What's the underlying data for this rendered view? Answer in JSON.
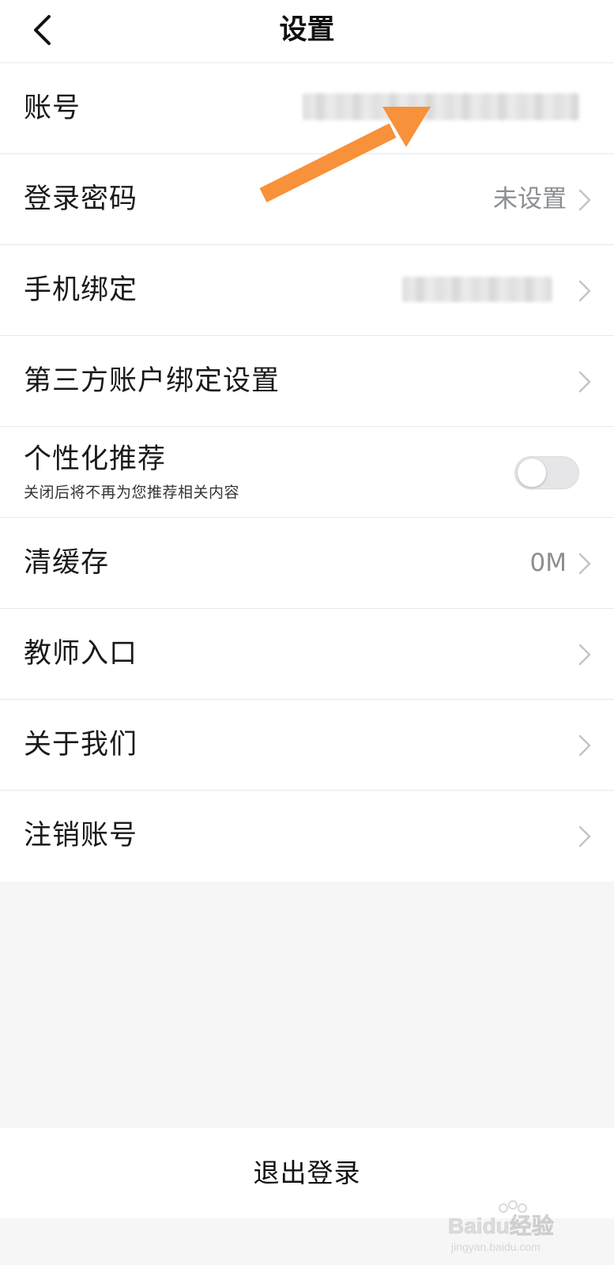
{
  "header": {
    "title": "设置",
    "back_icon": "chevron-left-icon"
  },
  "settings": {
    "account": {
      "label": "账号",
      "value_blurred": true
    },
    "login_password": {
      "label": "登录密码",
      "value": "未设置"
    },
    "phone_binding": {
      "label": "手机绑定",
      "value_blurred": true
    },
    "third_party": {
      "label": "第三方账户绑定设置"
    },
    "personalized": {
      "label": "个性化推荐",
      "subtitle": "关闭后将不再为您推荐相关内容",
      "enabled": false
    },
    "clear_cache": {
      "label": "清缓存",
      "value": "0M"
    },
    "teacher_entry": {
      "label": "教师入口"
    },
    "about_us": {
      "label": "关于我们"
    },
    "delete_account": {
      "label": "注销账号"
    }
  },
  "logout": {
    "label": "退出登录"
  },
  "annotation": {
    "arrow_color": "#f7913a",
    "target": "account"
  },
  "colors": {
    "background": "#f6f6f7",
    "row": "#ffffff",
    "value_text": "#8b8e92",
    "chevron": "#c2c4c7"
  },
  "watermark": {
    "logo_text": "Baidu经验",
    "url_text": "jingyan.baidu.com"
  }
}
